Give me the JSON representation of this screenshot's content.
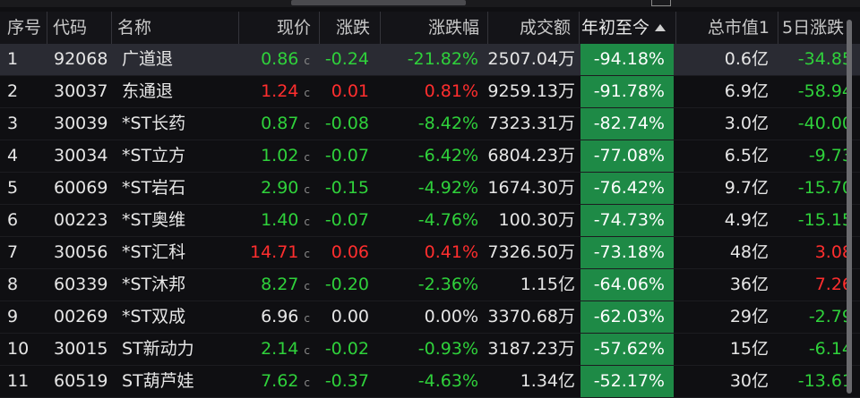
{
  "columns": {
    "seq": "序号",
    "code": "代码",
    "name": "名称",
    "price": "现价",
    "change": "涨跌",
    "change_pct": "涨跌幅",
    "turnover": "成交额",
    "ytd": "年初至今",
    "market_cap": "总市值1",
    "five_day": "5日涨跌"
  },
  "rows": [
    {
      "seq": "1",
      "code": "92068",
      "name": "广道退",
      "price": "0.86",
      "change": "-0.24",
      "change_pct": "-21.82%",
      "turnover": "2507.04万",
      "ytd": "-94.18%",
      "market_cap": "0.6亿",
      "five_day": "-34.85",
      "trend": "down",
      "five_trend": "down"
    },
    {
      "seq": "2",
      "code": "30037",
      "name": "东通退",
      "price": "1.24",
      "change": "0.01",
      "change_pct": "0.81%",
      "turnover": "9259.13万",
      "ytd": "-91.78%",
      "market_cap": "6.9亿",
      "five_day": "-58.94",
      "trend": "up",
      "five_trend": "down"
    },
    {
      "seq": "3",
      "code": "30039",
      "name": "*ST长药",
      "price": "0.87",
      "change": "-0.08",
      "change_pct": "-8.42%",
      "turnover": "7323.31万",
      "ytd": "-82.74%",
      "market_cap": "3.0亿",
      "five_day": "-40.00",
      "trend": "down",
      "five_trend": "down"
    },
    {
      "seq": "4",
      "code": "30034",
      "name": "*ST立方",
      "price": "1.02",
      "change": "-0.07",
      "change_pct": "-6.42%",
      "turnover": "6804.23万",
      "ytd": "-77.08%",
      "market_cap": "6.5亿",
      "five_day": "-9.73",
      "trend": "down",
      "five_trend": "down"
    },
    {
      "seq": "5",
      "code": "60069",
      "name": "*ST岩石",
      "price": "2.90",
      "change": "-0.15",
      "change_pct": "-4.92%",
      "turnover": "1674.30万",
      "ytd": "-76.42%",
      "market_cap": "9.7亿",
      "five_day": "-15.70",
      "trend": "down",
      "five_trend": "down"
    },
    {
      "seq": "6",
      "code": "00223",
      "name": "*ST奥维",
      "price": "1.40",
      "change": "-0.07",
      "change_pct": "-4.76%",
      "turnover": "100.30万",
      "ytd": "-74.73%",
      "market_cap": "4.9亿",
      "five_day": "-15.15",
      "trend": "down",
      "five_trend": "down"
    },
    {
      "seq": "7",
      "code": "30056",
      "name": "*ST汇科",
      "price": "14.71",
      "change": "0.06",
      "change_pct": "0.41%",
      "turnover": "7326.50万",
      "ytd": "-73.18%",
      "market_cap": "48亿",
      "five_day": "3.08",
      "trend": "up",
      "five_trend": "up"
    },
    {
      "seq": "8",
      "code": "60339",
      "name": "*ST沐邦",
      "price": "8.27",
      "change": "-0.20",
      "change_pct": "-2.36%",
      "turnover": "1.15亿",
      "ytd": "-64.06%",
      "market_cap": "36亿",
      "five_day": "7.26",
      "trend": "down",
      "five_trend": "up"
    },
    {
      "seq": "9",
      "code": "00269",
      "name": "*ST双成",
      "price": "6.96",
      "change": "0.00",
      "change_pct": "0.00%",
      "turnover": "3370.68万",
      "ytd": "-62.03%",
      "market_cap": "29亿",
      "five_day": "-2.79",
      "trend": "flat",
      "five_trend": "down"
    },
    {
      "seq": "10",
      "code": "30015",
      "name": "ST新动力",
      "price": "2.14",
      "change": "-0.02",
      "change_pct": "-0.93%",
      "turnover": "3187.23万",
      "ytd": "-57.62%",
      "market_cap": "15亿",
      "five_day": "-6.14",
      "trend": "down",
      "five_trend": "down"
    },
    {
      "seq": "11",
      "code": "60519",
      "name": "ST葫芦娃",
      "price": "7.62",
      "change": "-0.37",
      "change_pct": "-4.63%",
      "turnover": "1.34亿",
      "ytd": "-52.17%",
      "market_cap": "30亿",
      "five_day": "-13.61",
      "trend": "down",
      "five_trend": "down"
    }
  ],
  "price_suffix": "c",
  "colors": {
    "up": "#ff2e2e",
    "down": "#2fd13b",
    "flat": "#e6e6e6",
    "sorted_column_bg": "#1e8a46"
  },
  "selected_row": "1",
  "sort": {
    "column": "ytd",
    "direction": "asc"
  }
}
